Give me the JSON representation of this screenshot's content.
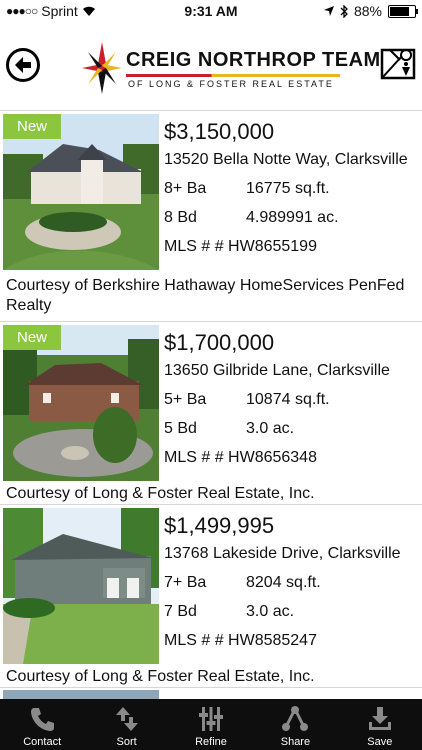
{
  "status": {
    "carrier": "Sprint",
    "time": "9:31 AM",
    "battery": "88%",
    "battery_level": 0.88
  },
  "header": {
    "logo_title": "CREIG NORTHROP TEAM",
    "logo_subtitle": "OF LONG & FOSTER REAL ESTATE"
  },
  "listings": [
    {
      "badge": "New",
      "price": "$3,150,000",
      "address": "13520 Bella Notte Way, Clarksville",
      "baths": "8+ Ba",
      "sqft": "16775 sq.ft.",
      "beds": "8 Bd",
      "acres": "4.989991 ac.",
      "mls": "MLS # # HW8655199",
      "courtesy": "Courtesy of Berkshire Hathaway HomeServices PenFed Realty"
    },
    {
      "badge": "New",
      "price": "$1,700,000",
      "address": "13650 Gilbride Lane, Clarksville",
      "baths": "5+ Ba",
      "sqft": "10874 sq.ft.",
      "beds": "5 Bd",
      "acres": "3.0 ac.",
      "mls": "MLS # # HW8656348",
      "courtesy": "Courtesy of Long & Foster Real Estate, Inc."
    },
    {
      "badge": "",
      "price": "$1,499,995",
      "address": "13768 Lakeside Drive, Clarksville",
      "baths": "7+ Ba",
      "sqft": "8204 sq.ft.",
      "beds": "7 Bd",
      "acres": "3.0 ac.",
      "mls": "MLS # # HW8585247",
      "courtesy": "Courtesy of Long & Foster Real Estate, Inc."
    }
  ],
  "tabs": [
    {
      "label": "Contact",
      "icon": "phone-icon"
    },
    {
      "label": "Sort",
      "icon": "sort-icon"
    },
    {
      "label": "Refine",
      "icon": "sliders-icon"
    },
    {
      "label": "Share",
      "icon": "share-icon"
    },
    {
      "label": "Save",
      "icon": "save-icon"
    }
  ],
  "colors": {
    "badge": "#8cc63f",
    "tabbar": "#0e0e0e",
    "logo_red": "#c8202f",
    "logo_gold": "#e8b623"
  }
}
